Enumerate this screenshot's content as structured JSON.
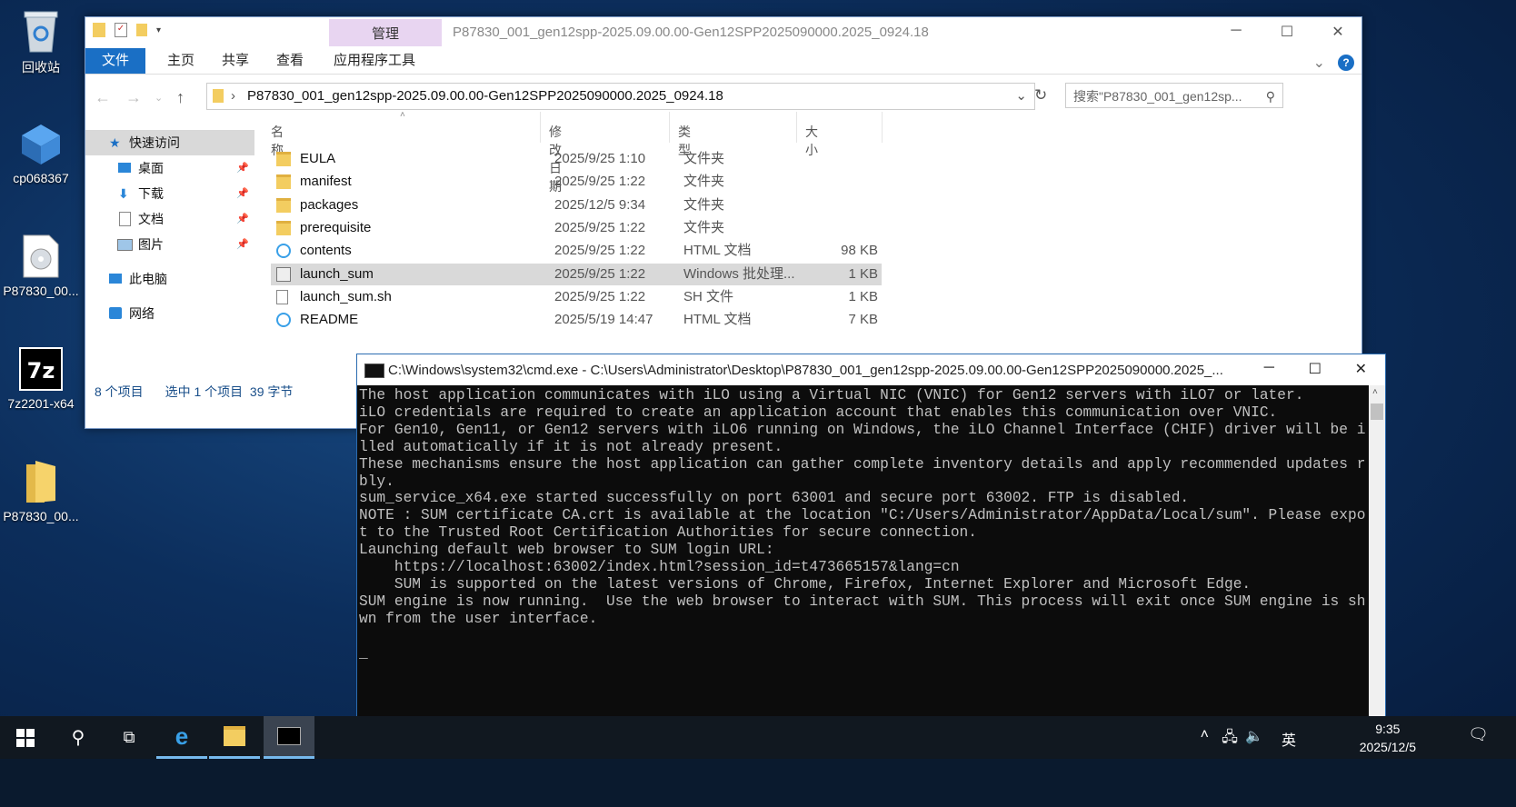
{
  "desktop": {
    "icons": [
      {
        "label": "回收站",
        "icon": "recycle-bin-icon"
      },
      {
        "label": "cp068367",
        "icon": "installer-package-icon"
      },
      {
        "label": "P87830_00...",
        "icon": "disc-image-icon"
      },
      {
        "label": "7z2201-x64",
        "icon": "7zip-icon"
      },
      {
        "label": "P87830_00...",
        "icon": "folder-icon"
      }
    ]
  },
  "explorer": {
    "title": "P87830_001_gen12spp-2025.09.00.00-Gen12SPP2025090000.2025_0924.18",
    "context_tab": "管理",
    "tabs": [
      "文件",
      "主页",
      "共享",
      "查看",
      "应用程序工具"
    ],
    "address": "P87830_001_gen12spp-2025.09.00.00-Gen12SPP2025090000.2025_0924.18",
    "search_placeholder": "搜索\"P87830_001_gen12sp...",
    "nav": {
      "quick_access": "快速访问",
      "items": [
        "桌面",
        "下载",
        "文档",
        "图片"
      ],
      "this_pc": "此电脑",
      "network": "网络"
    },
    "columns": [
      "名称",
      "修改日期",
      "类型",
      "大小"
    ],
    "files": [
      {
        "name": "EULA",
        "date": "2025/9/25 1:10",
        "type": "文件夹",
        "size": "",
        "icon": "folder-icon"
      },
      {
        "name": "manifest",
        "date": "2025/9/25 1:22",
        "type": "文件夹",
        "size": "",
        "icon": "folder-icon"
      },
      {
        "name": "packages",
        "date": "2025/12/5 9:34",
        "type": "文件夹",
        "size": "",
        "icon": "folder-icon"
      },
      {
        "name": "prerequisite",
        "date": "2025/9/25 1:22",
        "type": "文件夹",
        "size": "",
        "icon": "folder-icon"
      },
      {
        "name": "contents",
        "date": "2025/9/25 1:22",
        "type": "HTML 文档",
        "size": "98 KB",
        "icon": "html-file-icon"
      },
      {
        "name": "launch_sum",
        "date": "2025/9/25 1:22",
        "type": "Windows 批处理...",
        "size": "1 KB",
        "icon": "batch-file-icon",
        "selected": true
      },
      {
        "name": "launch_sum.sh",
        "date": "2025/9/25 1:22",
        "type": "SH 文件",
        "size": "1 KB",
        "icon": "text-file-icon"
      },
      {
        "name": "README",
        "date": "2025/5/19 14:47",
        "type": "HTML 文档",
        "size": "7 KB",
        "icon": "html-file-icon"
      }
    ],
    "status": {
      "count": "8 个项目",
      "selection": "选中 1 个项目  39 字节"
    }
  },
  "cmd": {
    "title": "C:\\Windows\\system32\\cmd.exe - C:\\Users\\Administrator\\Desktop\\P87830_001_gen12spp-2025.09.00.00-Gen12SPP2025090000.2025_...",
    "output": "The host application communicates with iLO using a Virtual NIC (VNIC) for Gen12 servers with iLO7 or later.\niLO credentials are required to create an application account that enables this communication over VNIC.\nFor Gen10, Gen11, or Gen12 servers with iLO6 running on Windows, the iLO Channel Interface (CHIF) driver will be insta\nlled automatically if it is not already present.\nThese mechanisms ensure the host application can gather complete inventory details and apply recommended updates relia\nbly.\nsum_service_x64.exe started successfully on port 63001 and secure port 63002. FTP is disabled.\nNOTE : SUM certificate CA.crt is available at the location \"C:/Users/Administrator/AppData/Local/sum\". Please export i\nt to the Trusted Root Certification Authorities for secure connection.\nLaunching default web browser to SUM login URL:\n    https://localhost:63002/index.html?session_id=t473665157&lang=cn\n    SUM is supported on the latest versions of Chrome, Firefox, Internet Explorer and Microsoft Edge.\nSUM engine is now running.  Use the web browser to interact with SUM. This process will exit once SUM engine is shutdo\nwn from the user interface.\n\n_"
  },
  "taskbar": {
    "ime": "英",
    "time": "9:35",
    "date": "2025/12/5"
  }
}
